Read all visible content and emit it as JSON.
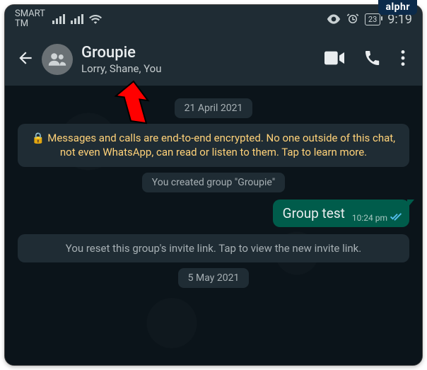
{
  "watermark": "alphr",
  "status": {
    "carrier_line1": "SMART",
    "carrier_line2": "TM",
    "battery": "23",
    "time": "9:19"
  },
  "header": {
    "title": "Groupie",
    "subtitle": "Lorry, Shane, You"
  },
  "dates": {
    "d1": "21 April 2021",
    "d2": "5 May 2021"
  },
  "encryption_notice_prefix": "🔒 ",
  "encryption_notice": "Messages and calls are end-to-end encrypted. No one outside of this chat, not even WhatsApp, can read or listen to them. Tap to learn more.",
  "system": {
    "created": "You created group \"Groupie\"",
    "invite_reset": "You reset this group's invite link. Tap to view the new invite link."
  },
  "message": {
    "text": "Group test",
    "time": "10:24 pm"
  }
}
